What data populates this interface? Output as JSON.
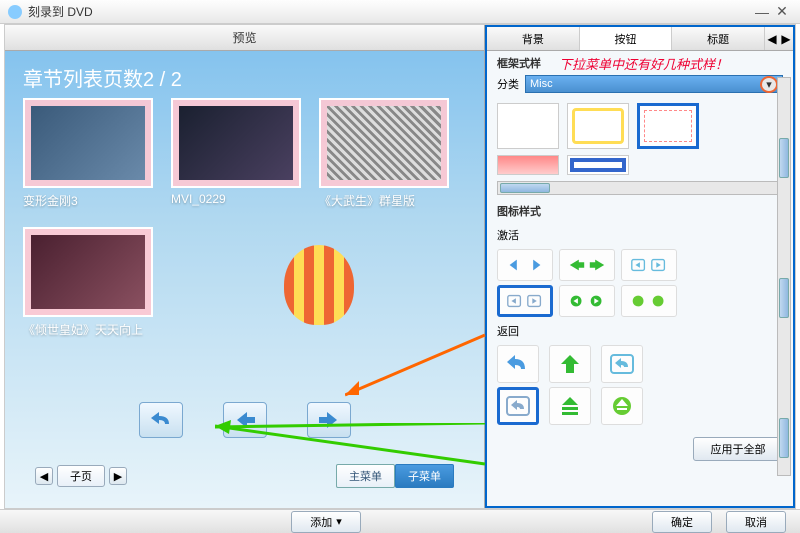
{
  "window_title": "刻录到 DVD",
  "preview_tab": "预览",
  "chapter_title": "章节列表页数2 / 2",
  "chapters": [
    {
      "label": "变形金刚3"
    },
    {
      "label": "MVI_0229"
    },
    {
      "label": "《大武生》群星版"
    },
    {
      "label": "《倾世皇妃》天天向上"
    }
  ],
  "page_nav_label": "子页",
  "menu_tabs": {
    "main": "主菜单",
    "sub": "子菜单"
  },
  "right_tabs": {
    "bg": "背景",
    "button": "按钮",
    "title": "标题"
  },
  "annotation": "下拉菜单中还有好几种式样！",
  "frame_section": "框架式样",
  "category_label": "分类",
  "category_value": "Misc",
  "icon_section": "图标样式",
  "activate_label": "激活",
  "return_label": "返回",
  "apply_all": "应用于全部",
  "footer": {
    "add": "添加",
    "ok": "确定",
    "cancel": "取消"
  }
}
